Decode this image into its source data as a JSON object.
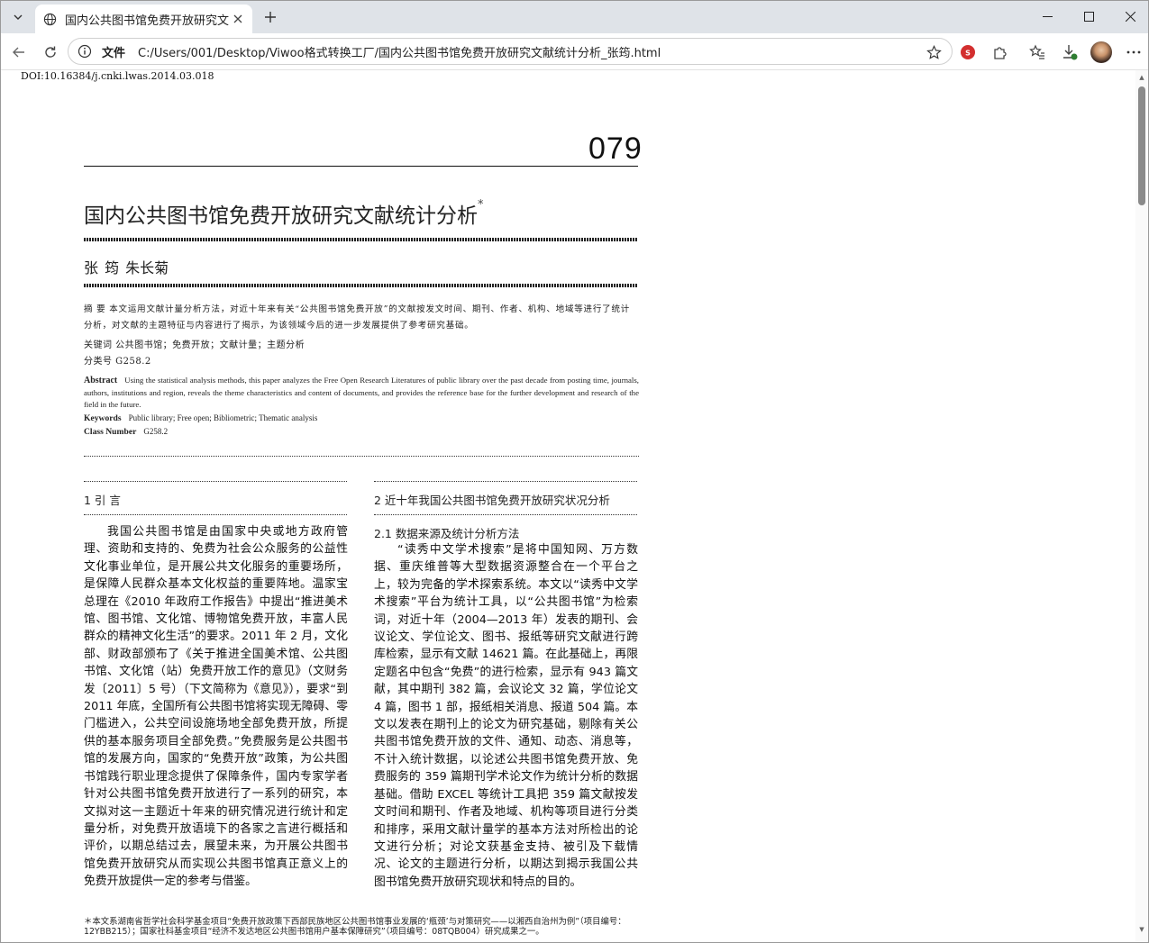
{
  "browser": {
    "tab_title": "国内公共图书馆免费开放研究文献",
    "url_scheme": "文件",
    "url": "C:/Users/001/Desktop/Viwoo格式转换工厂/国内公共图书馆免费开放研究文献统计分析_张筠.html"
  },
  "doc": {
    "doi": "DOI:10.16384/j.cnki.lwas.2014.03.018",
    "page_number": "079",
    "title": "国内公共图书馆免费开放研究文献统计分析",
    "title_mark": "*",
    "authors": "张  筠  朱长菊",
    "abstract_cn": "摘  要  本文运用文献计量分析方法，对近十年来有关“公共图书馆免费开放”的文献按发文时间、期刊、作者、机构、地域等进行了统计分析，对文献的主题特征与内容进行了揭示，为该领域今后的进一步发展提供了参考研究基础。",
    "keywords_cn": "关键词  公共图书馆；免费开放；文献计量；主题分析",
    "class_cn": "分类号  G258.2",
    "abstract_en_label": "Abstract",
    "abstract_en": "Using the statistical analysis methods, this paper analyzes the Free Open Research Literatures of public library over the past decade from posting time, journals, authors, institutions and region, reveals the theme characteristics and content of documents, and provides the reference base for the further development and research of the field in the future.",
    "keywords_en_label": "Keywords",
    "keywords_en": "Public library; Free open; Bibliometric; Thematic analysis",
    "class_en_label": "Class Number",
    "class_en": "G258.2",
    "sec1_title": "1  引  言",
    "sec1_para": "我国公共图书馆是由国家中央或地方政府管理、资助和支持的、免费为社会公众服务的公益性文化事业单位，是开展公共文化服务的重要场所，是保障人民群众基本文化权益的重要阵地。温家宝总理在《2010 年政府工作报告》中提出“推进美术馆、图书馆、文化馆、博物馆免费开放，丰富人民群众的精神文化生活”的要求。2011 年 2 月，文化部、财政部颁布了《关于推进全国美术馆、公共图书馆、文化馆（站）免费开放工作的意见》（文财务发〔2011〕5 号）（下文简称为《意见》），要求“到 2011 年底，全国所有公共图书馆将实现无障碍、零门槛进入，公共空间设施场地全部免费开放，所提供的基本服务项目全部免费。”免费服务是公共图书馆的发展方向，国家的“免费开放”政策，为公共图书馆践行职业理念提供了保障条件，国内专家学者针对公共图书馆免费开放进行了一系列的研究，本文拟对这一主题近十年来的研究情况进行统计和定量分析，对免费开放语境下的各家之言进行概括和评价，以期总结过去，展望未来，为开展公共图书馆免费开放研究从而实现公共图书馆真正意义上的免费开放提供一定的参考与借鉴。",
    "sec2_title": "2  近十年我国公共图书馆免费开放研究状况分析",
    "sec21_title": "2.1  数据来源及统计分析方法",
    "sec21_para": "“读秀中文学术搜索”是将中国知网、万方数据、重庆维普等大型数据资源整合在一个平台之上，较为完备的学术探索系统。本文以“读秀中文学术搜索”平台为统计工具，以“公共图书馆”为检索词，对近十年（2004—2013 年）发表的期刊、会议论文、学位论文、图书、报纸等研究文献进行跨库检索，显示有文献 14621 篇。在此基础上，再限定题名中包含“免费”的进行检索，显示有 943 篇文献，其中期刊 382 篇，会议论文 32 篇，学位论文 4 篇，图书 1 部，报纸相关消息、报道 504 篇。本文以发表在期刊上的论文为研究基础，剔除有关公共图书馆免费开放的文件、通知、动态、消息等，不计入统计数据，以论述公共图书馆免费开放、免费服务的 359 篇期刊学术论文作为统计分析的数据基础。借助 EXCEL 等统计工具把 359 篇文献按发文时间和期刊、作者及地域、机构等项目进行分类和排序，采用文献计量学的基本方法对所检出的论文进行分析；对论文获基金支持、被引及下载情况、论文的主题进行分析，以期达到揭示我国公共图书馆免费开放研究现状和特点的目的。",
    "footnote": "＊本文系湖南省哲学社会科学基金项目“免费开放政策下西部民族地区公共图书馆事业发展的‘瓶颈’与对策研究——以湘西自治州为例”（项目编号：12YBB215）；国家社科基金项目“经济不发达地区公共图书馆用户基本保障研究”（项目编号：08TQB004）研究成果之一。"
  }
}
